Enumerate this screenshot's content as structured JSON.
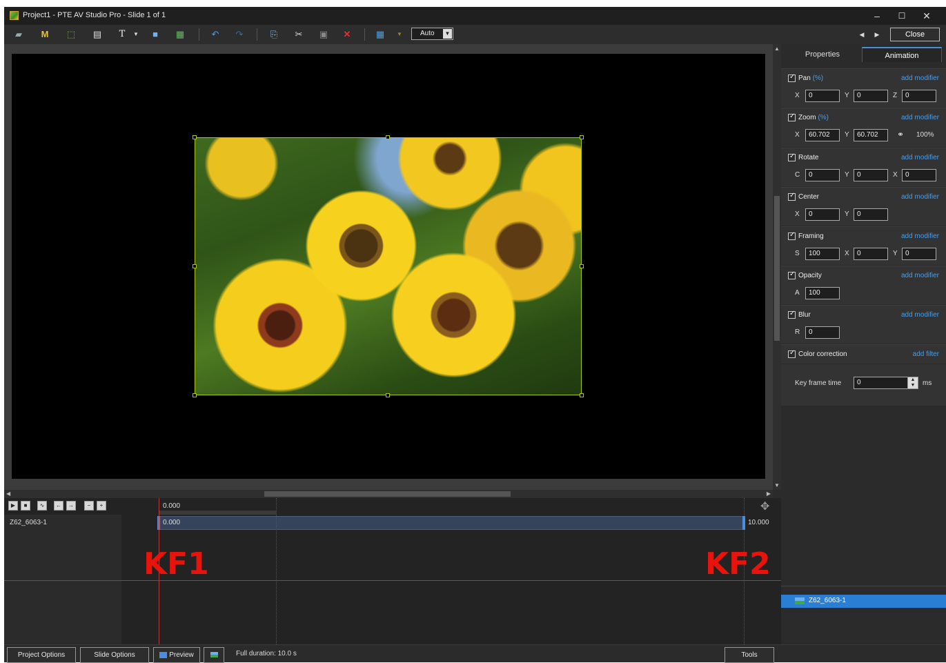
{
  "window": {
    "title": "Project1 - PTE AV Studio Pro - Slide 1 of 1"
  },
  "toolbar": {
    "zoom_mode": "Auto",
    "close_label": "Close",
    "icons": [
      "camera-icon",
      "mask-icon",
      "frame-icon",
      "image-icon",
      "text-icon",
      "dropdown-icon",
      "rectangle-icon",
      "picture-icon",
      "undo-icon",
      "redo-icon",
      "copy-icon",
      "cut-icon",
      "paste-icon",
      "delete-icon",
      "grid-icon",
      "prev-icon",
      "next-icon"
    ]
  },
  "panel": {
    "tabs": [
      "Properties",
      "Animation"
    ],
    "active_tab": "Animation",
    "add_modifier": "add modifier",
    "add_filter": "add filter",
    "pan": {
      "label": "Pan",
      "unit": "(%)",
      "x": "0",
      "y": "0",
      "z": "0"
    },
    "zoom": {
      "label": "Zoom",
      "unit": "(%)",
      "x": "60.702",
      "y": "60.702",
      "link": "100%"
    },
    "rotate": {
      "label": "Rotate",
      "c": "0",
      "y": "0",
      "x": "0"
    },
    "center": {
      "label": "Center",
      "x": "0",
      "y": "0"
    },
    "framing": {
      "label": "Framing",
      "s": "100",
      "x": "0",
      "y": "0"
    },
    "opacity": {
      "label": "Opacity",
      "a": "100"
    },
    "blur": {
      "label": "Blur",
      "r": "0"
    },
    "color_correction": {
      "label": "Color correction"
    },
    "key_frame_time": {
      "label": "Key frame time",
      "value": "0",
      "unit": "ms"
    },
    "letters": {
      "x": "X",
      "y": "Y",
      "z": "Z",
      "c": "C",
      "s": "S",
      "a": "A",
      "r": "R"
    },
    "object_item": "Z62_6063-1"
  },
  "timeline": {
    "ruler_time": "0.000",
    "track_name": "Z62_6063-1",
    "kf1_time": "0.000",
    "kf2_time": "10.000",
    "kf1_label": "KF1",
    "kf2_label": "KF2"
  },
  "bottom": {
    "project_options": "Project Options",
    "slide_options": "Slide Options",
    "preview": "Preview",
    "full_duration": "Full duration: 10.0 s",
    "tools": "Tools"
  },
  "colors": {
    "accent": "#4a9ee8",
    "selection": "#2a7fd4",
    "kf_marker": "#e8140c",
    "handles": "#a7c51a"
  }
}
